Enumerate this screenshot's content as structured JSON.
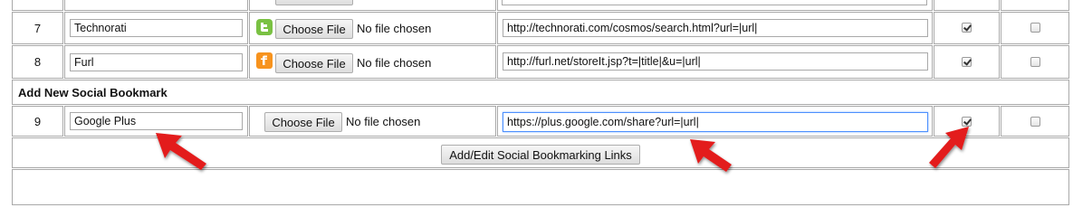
{
  "rows": [
    {
      "num": "7",
      "name": "Technorati",
      "file_button": "Choose File",
      "file_status": "No file chosen",
      "url": "http://technorati.com/cosmos/search.html?url=|url|",
      "checked_a": true,
      "checked_b": false,
      "icon": "technorati-icon",
      "icon_color": "#7ac143"
    },
    {
      "num": "8",
      "name": "Furl",
      "file_button": "Choose File",
      "file_status": "No file chosen",
      "url": "http://furl.net/storeIt.jsp?t=|title|&u=|url|",
      "checked_a": true,
      "checked_b": false,
      "icon": "furl-icon",
      "icon_color": "#f7931e"
    },
    {
      "num": "9",
      "name": "Google Plus",
      "file_button": "Choose File",
      "file_status": "No file chosen",
      "url": "https://plus.google.com/share?url=|url|",
      "checked_a": true,
      "checked_b": false
    }
  ],
  "section_title": "Add New Social Bookmark",
  "submit_label": "Add/Edit Social Bookmarking Links",
  "annotation_color": "#e31b1b"
}
